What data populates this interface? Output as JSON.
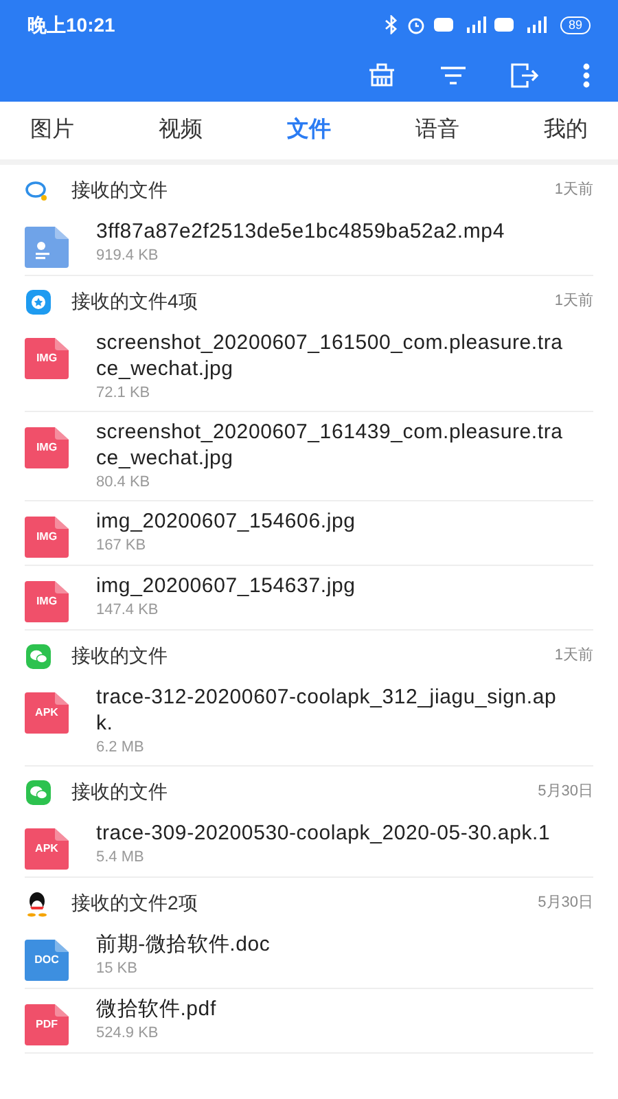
{
  "status_bar": {
    "time": "晚上10:21",
    "battery": "89"
  },
  "tabs": [
    {
      "label": "图片",
      "selected": false
    },
    {
      "label": "视频",
      "selected": false
    },
    {
      "label": "文件",
      "selected": true
    },
    {
      "label": "语音",
      "selected": false
    },
    {
      "label": "我的",
      "selected": false
    }
  ],
  "groups": [
    {
      "kind": "bubble",
      "title": "接收的文件",
      "time": "1天前",
      "files": [
        {
          "name": "3ff87a87e2f2513de5e1bc4859ba52a2.mp4",
          "size": "919.4 KB",
          "color": "#6fa3e8"
        }
      ]
    },
    {
      "kind": "star",
      "title": "接收的文件4项",
      "time": "1天前",
      "files": [
        {
          "name": "screenshot_20200607_161500_com.pleasure.trace_wechat.jpg",
          "size": "72.1 KB",
          "label": "IMG",
          "color": "#f0506a"
        },
        {
          "name": "screenshot_20200607_161439_com.pleasure.trace_wechat.jpg",
          "size": "80.4 KB",
          "label": "IMG",
          "color": "#f0506a"
        },
        {
          "name": "img_20200607_154606.jpg",
          "size": "167 KB",
          "label": "IMG",
          "color": "#f0506a"
        },
        {
          "name": "img_20200607_154637.jpg",
          "size": "147.4 KB",
          "label": "IMG",
          "color": "#f0506a"
        }
      ]
    },
    {
      "kind": "chat",
      "title": "接收的文件",
      "time": "1天前",
      "files": [
        {
          "name": "trace-312-20200607-coolapk_312_jiagu_sign.apk.",
          "size": "6.2 MB",
          "label": "APK",
          "color": "#f0506a"
        }
      ]
    },
    {
      "kind": "chat",
      "title": "接收的文件",
      "time": "5月30日",
      "files": [
        {
          "name": "trace-309-20200530-coolapk_2020-05-30.apk.1",
          "size": "5.4 MB",
          "label": "APK",
          "color": "#f0506a"
        }
      ]
    },
    {
      "kind": "penguin",
      "title": "接收的文件2项",
      "time": "5月30日",
      "files": [
        {
          "name": "前期-微拾软件.doc",
          "size": "15 KB",
          "label": "DOC",
          "color": "#3d8fe0"
        },
        {
          "name": "微拾软件.pdf",
          "size": "524.9 KB",
          "label": "PDF",
          "color": "#f0506a"
        }
      ]
    }
  ]
}
